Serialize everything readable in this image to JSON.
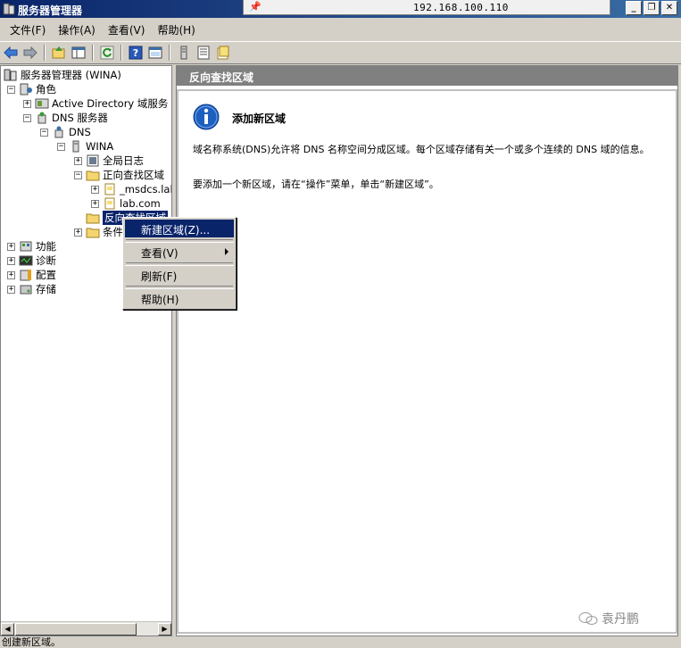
{
  "window": {
    "title": "服务器管理器",
    "remote_host": "192.168.100.110",
    "buttons": {
      "minimize": "_",
      "restore": "❐",
      "close": "✕"
    }
  },
  "menubar": [
    {
      "label": "文件(F)"
    },
    {
      "label": "操作(A)"
    },
    {
      "label": "查看(V)"
    },
    {
      "label": "帮助(H)"
    }
  ],
  "toolbar": {
    "icons": [
      "back-icon",
      "forward-icon",
      "up-icon",
      "show-hide-tree-icon",
      "refresh-icon",
      "help-icon",
      "properties-icon",
      "server-icon",
      "list-icon",
      "new-zone-icon"
    ]
  },
  "tree": {
    "root": "服务器管理器 (WINA)",
    "roles": "角色",
    "active_directory": "Active Directory 域服务",
    "dns_server": "DNS 服务器",
    "dns": "DNS",
    "wina": "WINA",
    "global_log": "全局日志",
    "forward_zones": "正向查找区域",
    "msdcs": "_msdcs.lab.com",
    "lab_com": "lab.com",
    "reverse_zones": "反向查找区域",
    "conditional": "条件转发器",
    "features": "功能",
    "diagnostics": "诊断",
    "configuration": "配置",
    "storage": "存储"
  },
  "content": {
    "header": "反向查找区域",
    "info_title": "添加新区域",
    "info_desc": "域名称系统(DNS)允许将 DNS 名称空间分成区域。每个区域存储有关一个或多个连续的 DNS 域的信息。",
    "info_instr": "要添加一个新区域，请在“操作”菜单，单击“新建区域”。"
  },
  "context_menu": {
    "new_zone": "新建区域(Z)...",
    "view": "查看(V)",
    "refresh": "刷新(F)",
    "help": "帮助(H)"
  },
  "statusbar": {
    "text": "创建新区域。"
  },
  "watermark": {
    "text": "袁丹鹏"
  },
  "colors": {
    "title_bar": "#0a246a",
    "selection": "#0a246a",
    "content_header": "#808080",
    "info_icon": "#1d5fbf"
  }
}
